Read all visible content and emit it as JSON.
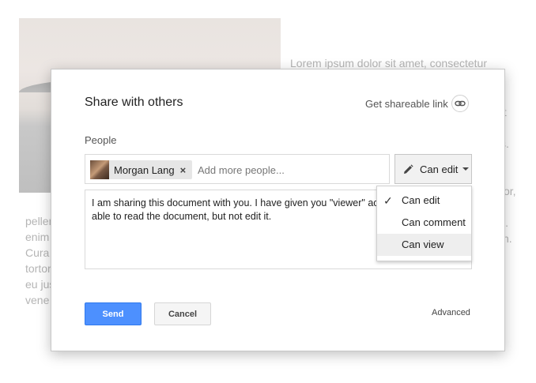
{
  "background": {
    "right_lines": [
      "Lorem ipsum dolor sit amet, consectetur"
    ],
    "right_fragments": [
      "r",
      "ut",
      "s.",
      "or,",
      "i.",
      "n."
    ],
    "left_lines": [
      "pellen",
      "enim",
      "Cura",
      "tortor",
      "eu jus",
      "vene"
    ]
  },
  "dialog": {
    "title": "Share with others",
    "shareable_link_label": "Get shareable link",
    "people_label": "People",
    "chip_name": "Morgan Lang",
    "chip_remove": "×",
    "people_placeholder": "Add more people...",
    "permission_label": "Can edit",
    "message": "I am sharing this document with you. I have given you \"viewer\" access, so you will be able to read the document, but not edit it.",
    "dropdown": [
      {
        "label": "Can edit",
        "checked": true
      },
      {
        "label": "Can comment",
        "checked": false
      },
      {
        "label": "Can view",
        "checked": false
      }
    ],
    "send_label": "Send",
    "cancel_label": "Cancel",
    "advanced_label": "Advanced"
  },
  "icons": {
    "link": "link-icon",
    "pencil": "pencil-icon",
    "check": "checkmark-icon",
    "caret": "chevron-down-icon"
  },
  "colors": {
    "primary": "#4d90fe",
    "hover": "#eeeeee"
  }
}
